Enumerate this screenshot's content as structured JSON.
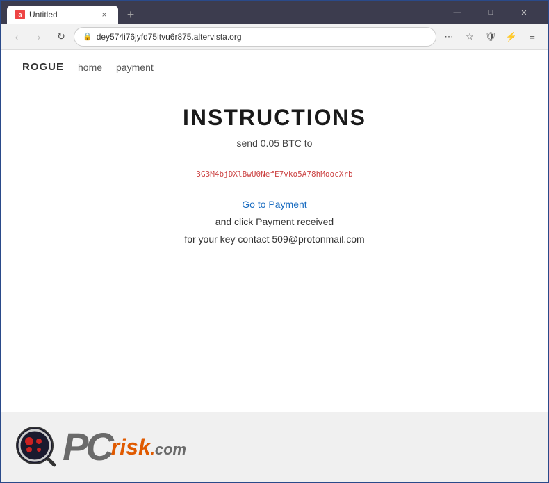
{
  "browser": {
    "tab": {
      "favicon_label": "a",
      "title": "Untitled",
      "close_label": "×"
    },
    "new_tab_label": "+",
    "window_controls": {
      "minimize": "—",
      "maximize": "□",
      "close": "✕"
    },
    "nav": {
      "back_label": "‹",
      "forward_label": "›",
      "refresh_label": "↻",
      "address": "dey574i76jyfd75itvu6r875.altervista.org",
      "more_label": "⋯",
      "bookmark_label": "☆",
      "shield_label": "🛡",
      "extensions_label": "⚡",
      "menu_label": "≡"
    }
  },
  "site": {
    "brand": "ROGUE",
    "nav_links": [
      "home",
      "payment"
    ]
  },
  "page": {
    "title": "INSTRUCTIONS",
    "subtitle": "send 0.05 BTC to",
    "btc_address": "3G3M4bjDXlBwU0NefE7vko5A78hMoocXrb",
    "go_to_payment_text": "Go to Payment",
    "go_to_payment_link": "payment",
    "click_payment_text": "and click Payment received",
    "contact_text": "for your key contact 509@protonmail.com"
  },
  "watermark": {
    "pc_text": "PC",
    "risk_text": "risk",
    "dot_text": ".",
    "com_text": "com"
  }
}
